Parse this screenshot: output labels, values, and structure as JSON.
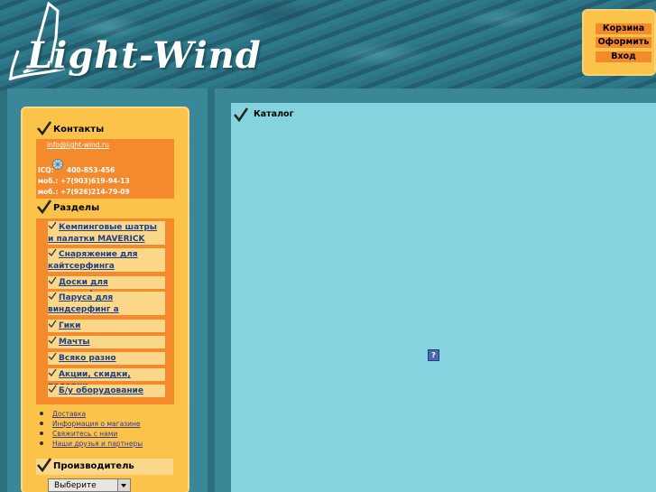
{
  "header": {
    "logo_text": "Light-Wind",
    "menu": [
      {
        "label": "Корзина"
      },
      {
        "label": "Оформить"
      },
      {
        "label": "Вход"
      }
    ]
  },
  "contacts": {
    "title": "Контакты",
    "email": "info@light-wind.ru",
    "icq_label": "ICQ:",
    "icq": "400-853-456",
    "phone1": "моб.: +7(903)619-94-13",
    "phone2": "моб.: +7(926)214-79-09"
  },
  "sections": {
    "title": "Разделы",
    "items": [
      {
        "label": "Кемпинговые шатры и палатки MAVERICK"
      },
      {
        "label": "Снаряжение для кайтсерфинга"
      },
      {
        "label": "Доски для виндсерфинга"
      },
      {
        "label": "Паруса для виндсерфинг а"
      },
      {
        "label": "Гики"
      },
      {
        "label": "Мачты"
      },
      {
        "label": "Всяко разно"
      },
      {
        "label": "Акции, скидки, подарки"
      },
      {
        "label": "Б/у оборудование"
      }
    ]
  },
  "info_links": [
    {
      "label": "Доставка"
    },
    {
      "label": "Информация о магазине"
    },
    {
      "label": "Свяжитесь с нами"
    },
    {
      "label": "Наши друзья и партнеры"
    }
  ],
  "manufacturer": {
    "title": "Производитель",
    "select_value": "Выберите"
  },
  "main": {
    "title": "Каталог",
    "broken_image_glyph": "?"
  },
  "colors": {
    "accent_orange": "#f58a2c",
    "panel_yellow": "#fbc34a",
    "content_bg": "#85d3df",
    "link_blue": "#1b3f8a"
  }
}
